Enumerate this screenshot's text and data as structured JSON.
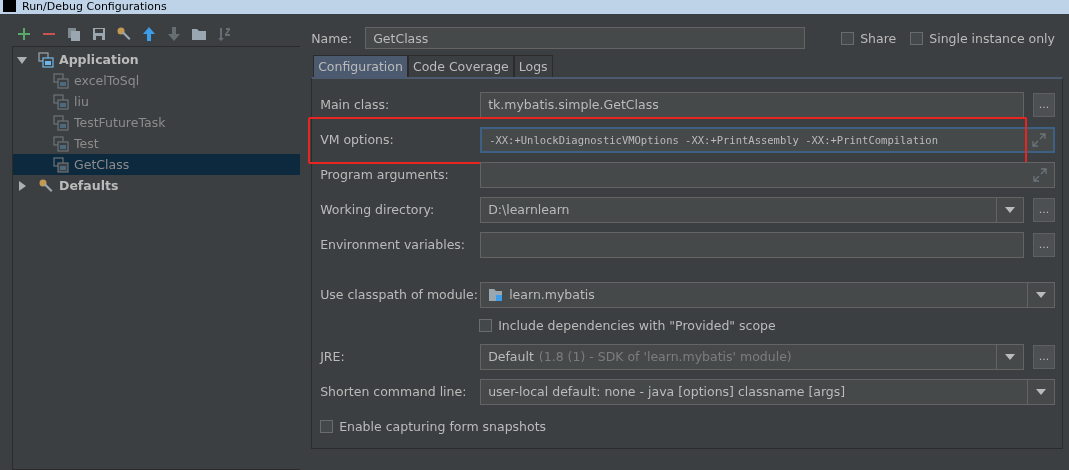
{
  "window": {
    "title": "Run/Debug Configurations"
  },
  "toolbar": [
    {
      "kind": "add",
      "disabled": false
    },
    {
      "kind": "remove",
      "disabled": false
    },
    {
      "kind": "copy",
      "disabled": false
    },
    {
      "kind": "save",
      "disabled": false
    },
    {
      "kind": "wrench",
      "disabled": false
    },
    {
      "kind": "up",
      "disabled": false
    },
    {
      "kind": "down",
      "disabled": true
    },
    {
      "kind": "folder",
      "disabled": false
    },
    {
      "kind": "sort",
      "disabled": true
    }
  ],
  "tree": [
    {
      "label": "Application",
      "kind": "app",
      "expanded": true,
      "selected": false,
      "children": [
        {
          "label": "excelToSql",
          "kind": "config",
          "selected": false
        },
        {
          "label": "liu",
          "kind": "config",
          "selected": false
        },
        {
          "label": "TestFutureTask",
          "kind": "config",
          "selected": false
        },
        {
          "label": "Test",
          "kind": "config",
          "selected": false
        },
        {
          "label": "GetClass",
          "kind": "config",
          "selected": true
        }
      ]
    },
    {
      "label": "Defaults",
      "kind": "defaults",
      "expanded": false,
      "selected": false
    }
  ],
  "name": {
    "label": "Name:",
    "value": "GetClass"
  },
  "options": [
    {
      "label": "Share",
      "checked": false
    },
    {
      "label": "Single instance only",
      "checked": false
    }
  ],
  "tabs": [
    {
      "label": "Configuration",
      "selected": true
    },
    {
      "label": "Code Coverage",
      "selected": false
    },
    {
      "label": "Logs",
      "selected": false
    }
  ],
  "fields": [
    {
      "kind": "text",
      "label": "Main class:",
      "value": "tk.mybatis.simple.GetClass",
      "button": "..."
    },
    {
      "kind": "expand",
      "label": "VM options:",
      "value": "-XX:+UnlockDiagnosticVMOptions -XX:+PrintAssembly -XX:+PrintCompilation",
      "highlighted": true
    },
    {
      "kind": "expand",
      "label": "Program arguments:"
    },
    {
      "kind": "combo",
      "label": "Working directory:",
      "value": "D:\\learnlearn",
      "button": "..."
    },
    {
      "kind": "text",
      "label": "Environment variables:",
      "button": "..."
    },
    {
      "kind": "gap"
    },
    {
      "kind": "module",
      "label": "Use classpath of module:",
      "value": "learn.mybatis"
    },
    {
      "kind": "checkbox",
      "label": "Include dependencies with \"Provided\" scope",
      "checked": false,
      "indent": true
    },
    {
      "kind": "jre",
      "label": "JRE:",
      "value": "Default",
      "detail": "(1.8 (1) - SDK of 'learn.mybatis' module)",
      "button": "..."
    },
    {
      "kind": "combo",
      "label": "Shorten command line:",
      "value": "user-local default: none - java [options] classname [args]"
    },
    {
      "kind": "checkbox",
      "label": "Enable capturing form snapshots",
      "checked": false,
      "indent": false
    }
  ]
}
